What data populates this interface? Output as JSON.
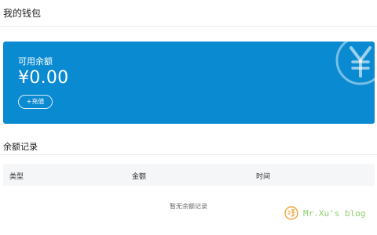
{
  "header": {
    "title": "我的钱包"
  },
  "wallet": {
    "balance_label": "可用余额",
    "balance_amount": "¥0.00",
    "recharge_label": "+充值",
    "watermark_icon": "yen-circle-icon"
  },
  "records": {
    "section_title": "余额记录",
    "columns": [
      "类型",
      "金额",
      "时间"
    ],
    "empty_text": "暂无余额记录"
  },
  "watermark": {
    "text": "Mr.Xu's blog",
    "logo_icon": "blog-logo-icon"
  },
  "colors": {
    "card_bg": "#0a8ad0",
    "table_header_bg": "#f5f6f8",
    "watermark_green": "#8fcf6a",
    "watermark_orange": "#f2a43a"
  }
}
